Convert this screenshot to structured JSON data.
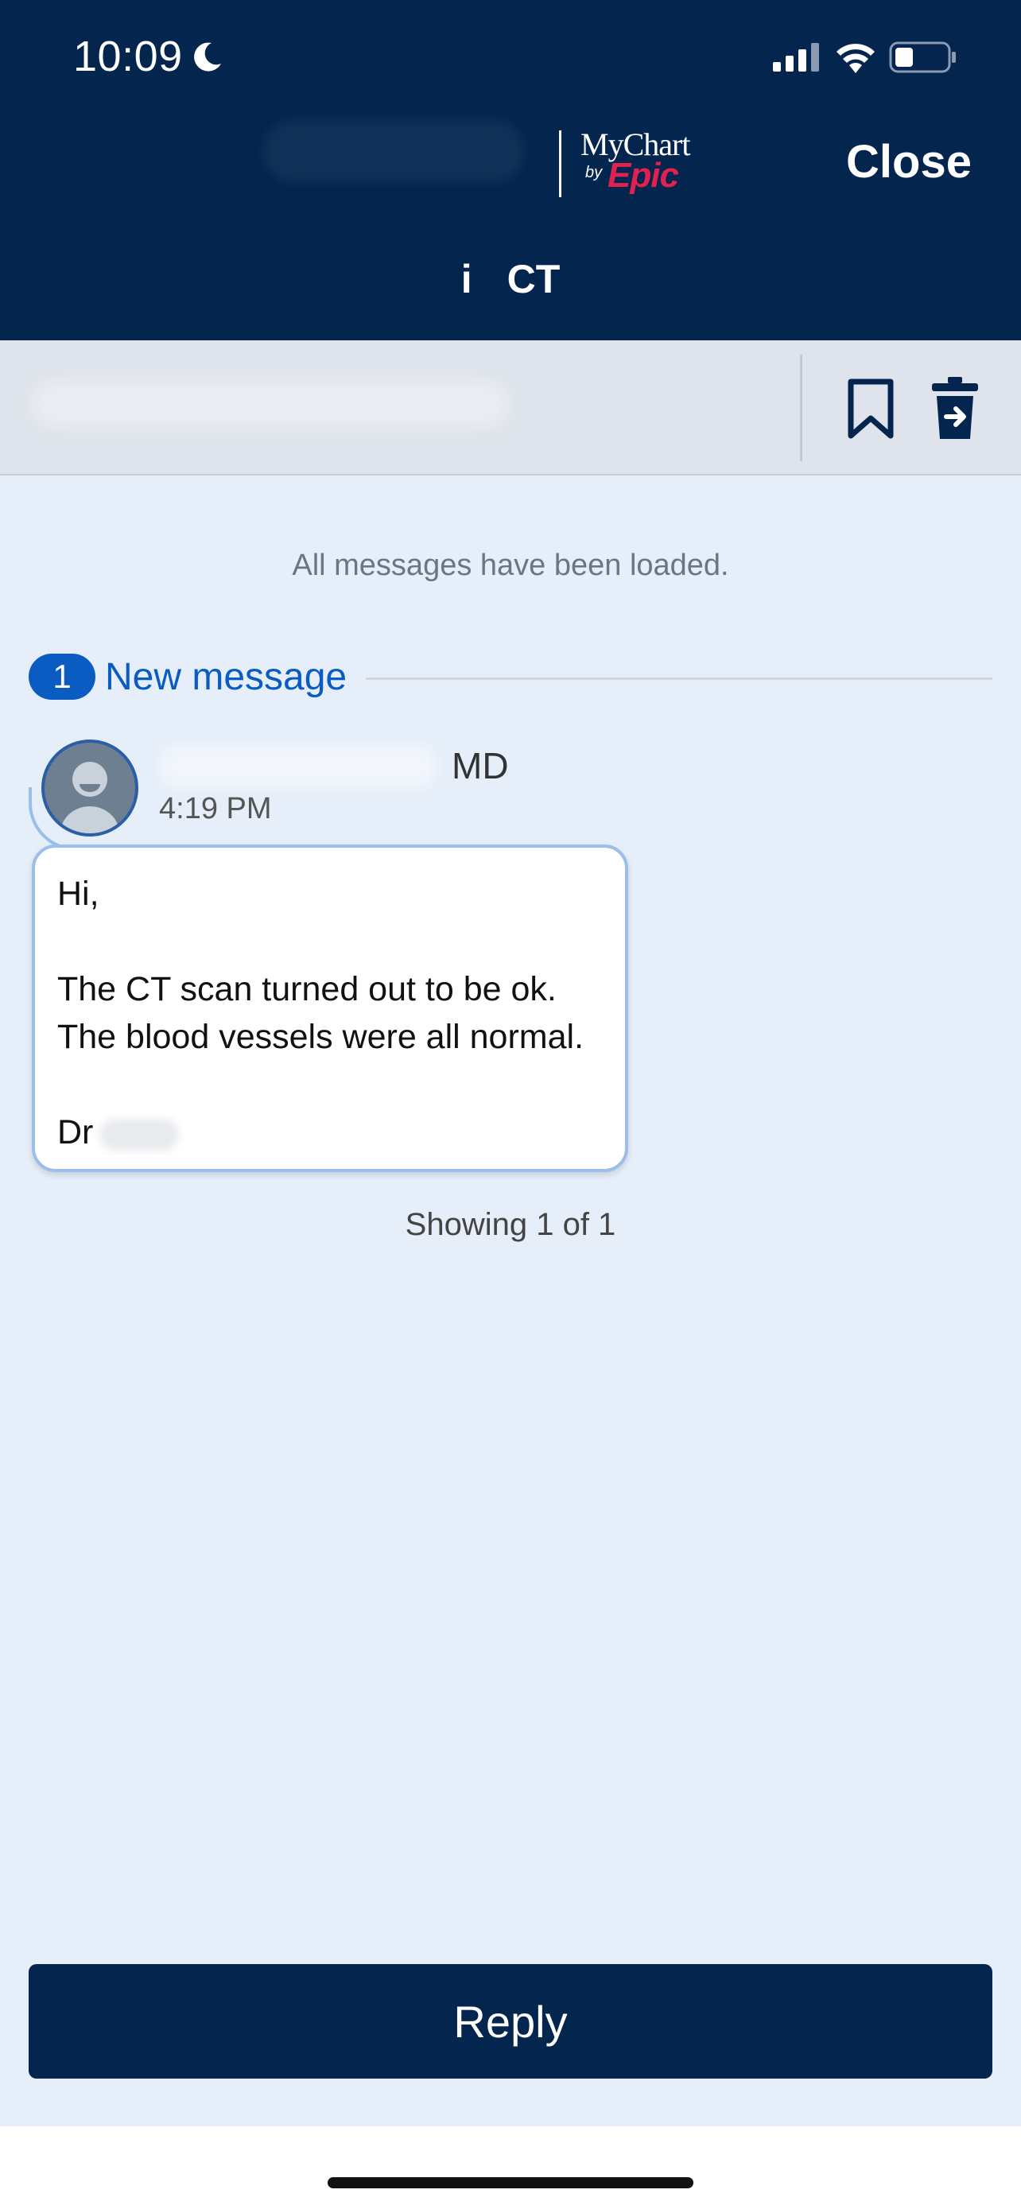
{
  "status_bar": {
    "time": "10:09",
    "icons": [
      "moon-icon",
      "signal-icon",
      "wifi-icon",
      "battery-icon"
    ]
  },
  "header": {
    "brand_mychart": "MyChart",
    "brand_by": "by",
    "brand_epic": "Epic",
    "close_label": "Close",
    "subject_marker": "i",
    "subject": "CT"
  },
  "toolbar": {
    "icons": [
      "bookmark-icon",
      "trash-icon"
    ]
  },
  "thread": {
    "loaded_notice": "All messages have been loaded.",
    "new_count": "1",
    "new_label": "New message",
    "message": {
      "sender_suffix": "MD",
      "time": "4:19 PM",
      "body_lines": [
        "Hi,",
        "",
        "The CT scan turned out to be ok.",
        "The blood vessels were all normal.",
        "",
        "Dr"
      ]
    },
    "showing": "Showing 1 of 1"
  },
  "footer": {
    "reply_label": "Reply"
  },
  "colors": {
    "header_bg": "#04254e",
    "page_bg": "#e5eef9",
    "accent_blue": "#0a5cc2",
    "epic_red": "#e0234e"
  }
}
